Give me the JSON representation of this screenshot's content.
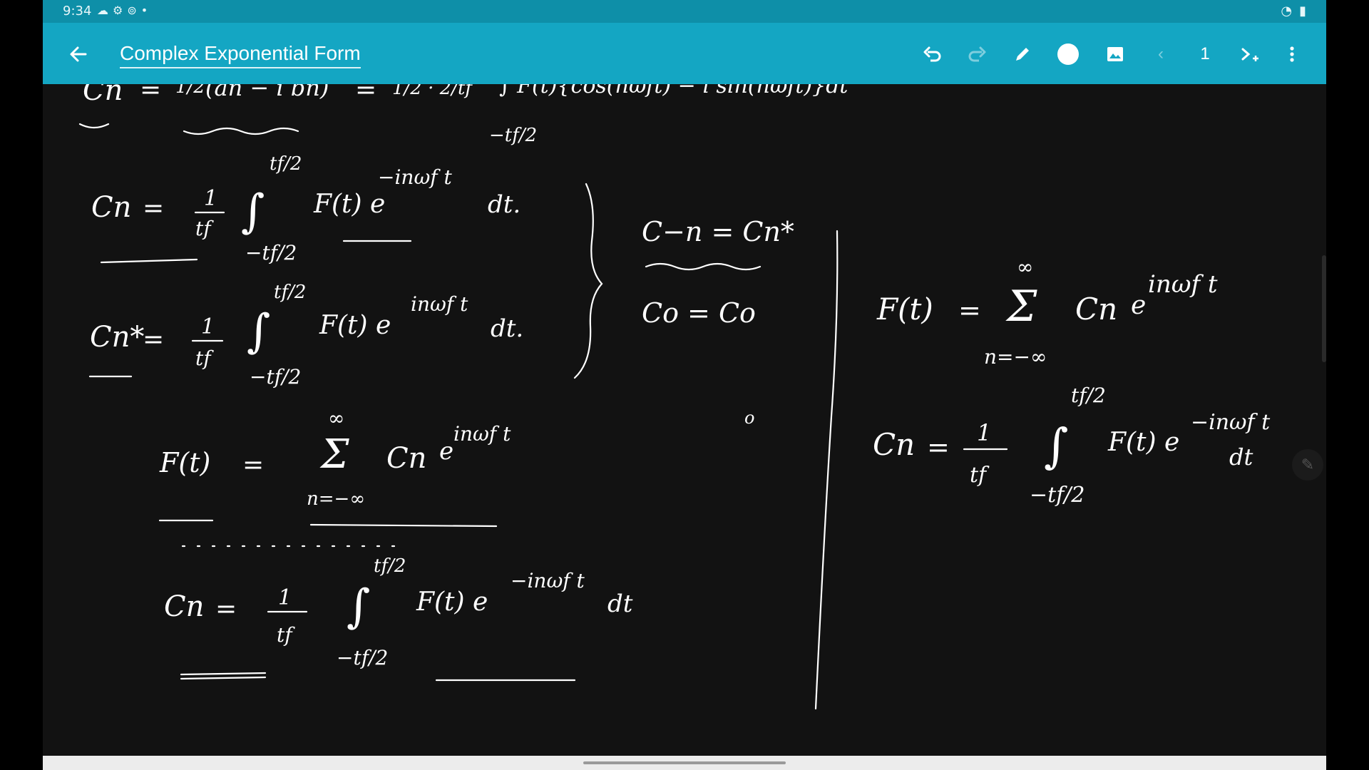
{
  "status_bar": {
    "time": "9:34",
    "icons": [
      "cloud-icon",
      "settings-icon",
      "sync-icon",
      "dot-icon"
    ],
    "right_icons": [
      "wifi-icon",
      "battery-icon"
    ]
  },
  "app_bar": {
    "title": "Complex Exponential Form",
    "page_number": "1",
    "accent_color": "#14a6c3",
    "toolbar_icons": [
      "undo-icon",
      "redo-icon",
      "pen-icon",
      "color-circle-icon",
      "image-icon",
      "prev-page-icon",
      "next-page-add-icon",
      "more-vert-icon"
    ]
  },
  "handwriting": {
    "top_partial": {
      "lhs": "Cn",
      "eq1": "=",
      "half": "1/2",
      "paren": "(an − i bn)",
      "eq2": "=",
      "frac": "1/2 · 2/tf",
      "integral_tail": "∫ F(t){cos(nωft) − i sin(nωft)}dt",
      "lower_limit": "−tf/2"
    },
    "eq_cn": {
      "lhs": "Cn",
      "eq": "=",
      "num": "1",
      "den": "tf",
      "upper": "tf/2",
      "lower": "−tf/2",
      "body": "F(t) e",
      "exp": "−inωf t",
      "dt": "dt."
    },
    "eq_cn_star": {
      "lhs": "Cn*",
      "eq": "=",
      "num": "1",
      "den": "tf",
      "upper": "tf/2",
      "lower": "−tf/2",
      "body": "F(t) e",
      "exp": "inωf t",
      "dt": "dt."
    },
    "conj_rel": {
      "line1": "C−n = Cn*",
      "line2": "Co = Co"
    },
    "fourier_series": {
      "lhs": "F(t)",
      "eq": "=",
      "sum_top": "∞",
      "sum_sym": "Σ",
      "sum_bottom": "n=−∞",
      "term": "Cn",
      "e": "e",
      "exp": "inωf t"
    },
    "coef_bottom": {
      "lhs": "Cn",
      "eq": "=",
      "num": "1",
      "den": "tf",
      "upper": "tf/2",
      "lower": "−tf/2",
      "body": "F(t) e",
      "exp": "−inωf t",
      "dt": "dt"
    },
    "stray_mark": "o",
    "right_series": {
      "lhs": "F(t)",
      "eq": "=",
      "sum_top": "∞",
      "sum_sym": "Σ",
      "sum_bottom": "n=−∞",
      "term": "Cn",
      "e": "e",
      "exp": "inωf t"
    },
    "right_coef": {
      "lhs": "Cn",
      "eq": "=",
      "num": "1",
      "den": "tf",
      "upper": "tf/2",
      "lower": "−tf/2",
      "body": "F(t) e",
      "exp": "−inωf t",
      "dt": "dt"
    }
  }
}
